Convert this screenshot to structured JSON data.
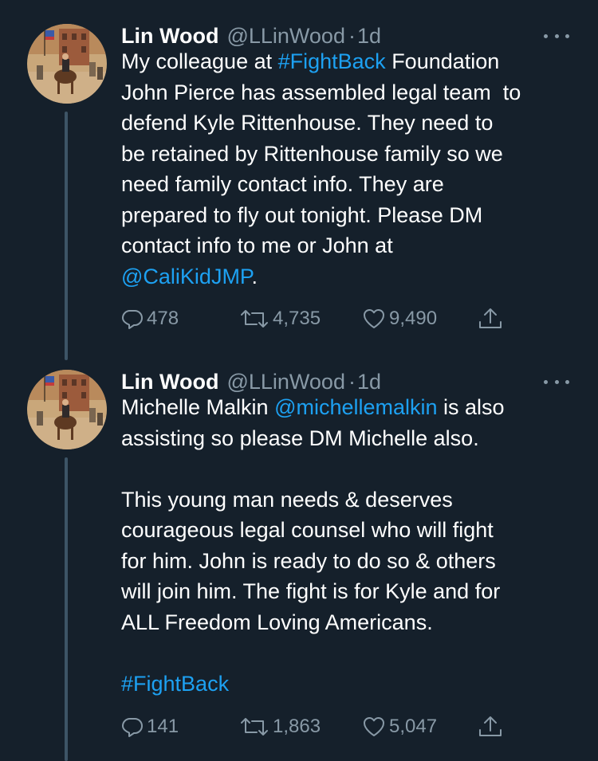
{
  "tweets": [
    {
      "author_name": "Lin Wood",
      "handle": "@LLinWood",
      "separator": "·",
      "time": "1d",
      "body": {
        "t1": "My colleague at ",
        "hashtag": "#FightBack",
        "t2": " Foundation\nJohn Pierce has assembled legal team  to\ndefend Kyle Rittenhouse. They need to\nbe retained by Rittenhouse family so we\nneed family contact info. They are\nprepared to fly out tonight. Please DM\ncontact info to me or John at\n",
        "mention": "@CaliKidJMP",
        "t3": "."
      },
      "replies": "478",
      "retweets": "4,735",
      "likes": "9,490"
    },
    {
      "author_name": "Lin Wood",
      "handle": "@LLinWood",
      "separator": "·",
      "time": "1d",
      "body": {
        "t1": "Michelle Malkin ",
        "mention": "@michellemalkin",
        "t2": " is also\nassisting so please DM Michelle also.\n\nThis young man needs & deserves\ncourageous legal counsel who will fight\nfor him. John is ready to do so & others\nwill join him. The fight is for Kyle and for\nALL Freedom Loving Americans.\n\n",
        "hashtag": "#FightBack"
      },
      "replies": "141",
      "retweets": "1,863",
      "likes": "5,047"
    }
  ],
  "icons": {
    "reply": "reply-icon",
    "retweet": "retweet-icon",
    "like": "heart-icon",
    "share": "share-icon",
    "more": "more-icon"
  },
  "colors": {
    "background": "#15202b",
    "text": "#ffffff",
    "secondary": "#8899a6",
    "link": "#1da1f2",
    "thread_line": "#3d5466"
  }
}
